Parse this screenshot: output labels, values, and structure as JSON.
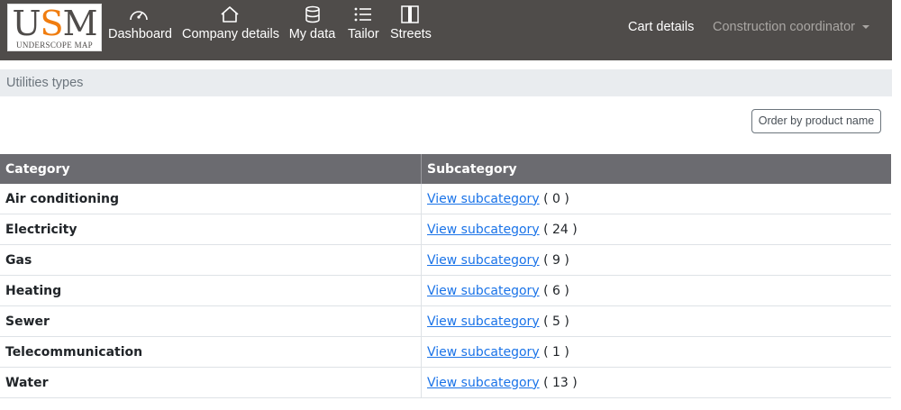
{
  "logo": {
    "letters": [
      "U",
      "S",
      "M"
    ],
    "tagline": "UNDERSCOPE MAP"
  },
  "nav": {
    "items": [
      {
        "label": "Dashboard",
        "icon": "gauge-icon"
      },
      {
        "label": "Company details",
        "icon": "home-icon"
      },
      {
        "label": "My data",
        "icon": "database-icon"
      },
      {
        "label": "Tailor",
        "icon": "list-icon"
      },
      {
        "label": "Streets",
        "icon": "columns-icon"
      }
    ],
    "cart_label": "Cart details",
    "user_menu_label": "Construction coordinator"
  },
  "section": {
    "title": "Utilities types"
  },
  "order_button": {
    "label": "Order by product name"
  },
  "table": {
    "headers": [
      "Category",
      "Subcategory"
    ],
    "link_text": "View subcategory",
    "rows": [
      {
        "category": "Air conditioning",
        "count": "( 0 )"
      },
      {
        "category": "Electricity",
        "count": "( 24 )"
      },
      {
        "category": "Gas",
        "count": "( 9 )"
      },
      {
        "category": "Heating",
        "count": "( 6 )"
      },
      {
        "category": "Sewer",
        "count": "( 5 )"
      },
      {
        "category": "Telecommunication",
        "count": "( 1 )"
      },
      {
        "category": "Water",
        "count": "( 13 )"
      }
    ]
  },
  "colors": {
    "navbar": "#4f4c4a",
    "logo_accent": "#f07d10",
    "table_header": "#6b6b70",
    "link": "#1a73e8"
  }
}
